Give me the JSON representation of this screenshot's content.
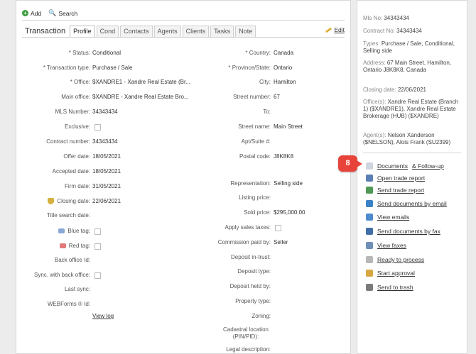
{
  "toolbar": {
    "add_label": "Add",
    "search_label": "Search"
  },
  "tabs": {
    "title": "Transaction",
    "items": [
      "Profile",
      "Cond",
      "Contacts",
      "Agents",
      "Clients",
      "Tasks",
      "Note"
    ],
    "active": "Profile",
    "edit_label": "Edit"
  },
  "left_fields": [
    {
      "label": "* Status:",
      "value": "Conditional"
    },
    {
      "label": "* Transaction type:",
      "value": "Purchase / Sale"
    },
    {
      "label": "* Office:",
      "value": "$XANDRE1 - Xandre Real Estate (Br..."
    },
    {
      "label": "Main office:",
      "value": "$XANDRE - Xandre Real Estate Bro..."
    },
    {
      "label": "MLS Number:",
      "value": "34343434"
    },
    {
      "label": "Exclusive:",
      "value": ""
    },
    {
      "label": "Contract number:",
      "value": "34343434"
    },
    {
      "label": "Offer date:",
      "value": "18/05/2021"
    },
    {
      "label": "Accepted date:",
      "value": "18/05/2021"
    },
    {
      "label": "Firm date:",
      "value": "31/05/2021"
    },
    {
      "label": "Closing date:",
      "value": "22/06/2021"
    },
    {
      "label": "Title search date:",
      "value": ""
    },
    {
      "label": "Blue tag:",
      "value": ""
    },
    {
      "label": "Red tag:",
      "value": ""
    },
    {
      "label": "Back office Id:",
      "value": ""
    },
    {
      "label": "Sync. with back office:",
      "value": ""
    },
    {
      "label": "Last sync:",
      "value": ""
    },
    {
      "label": "WEBForms ® Id:",
      "value": ""
    }
  ],
  "view_log_label": "View log",
  "right_fields": [
    {
      "label": "* Country:",
      "value": "Canada"
    },
    {
      "label": "* Province/State:",
      "value": "Ontario"
    },
    {
      "label": "City:",
      "value": "Hamilton"
    },
    {
      "label": "Street number:",
      "value": "67"
    },
    {
      "label": "To:",
      "value": ""
    },
    {
      "label": "Street name:",
      "value": "Main Street"
    },
    {
      "label": "Apt/Suite #:",
      "value": ""
    },
    {
      "label": "Postal code:",
      "value": "J8K8K8"
    },
    {
      "label": "Representation:",
      "value": "Selling side"
    },
    {
      "label": "Listing price:",
      "value": ""
    },
    {
      "label": "Sold price:",
      "value": "$295,000.00"
    },
    {
      "label": "Apply sales taxes:",
      "value": ""
    },
    {
      "label": "Commission paid by:",
      "value": "Seller"
    },
    {
      "label": "Deposit in-trust:",
      "value": ""
    },
    {
      "label": "Deposit type:",
      "value": ""
    },
    {
      "label": "Deposit held by:",
      "value": ""
    },
    {
      "label": "Property type:",
      "value": ""
    },
    {
      "label": "Zoning:",
      "value": ""
    },
    {
      "label": "Cadastral location (PIN/PID):",
      "value": ""
    },
    {
      "label": "Legal description:",
      "value": ""
    }
  ],
  "side": {
    "mls": {
      "label": "Mls No:",
      "value": "34343434"
    },
    "contract": {
      "label": "Contract No:",
      "value": "34343434"
    },
    "types": {
      "label": "Types:",
      "value": "Purchase / Sale, Conditional, Selling side"
    },
    "address": {
      "label": "Address:",
      "value": "67 Main Street, Hamilton, Ontario J8K8K8, Canada"
    },
    "closing": {
      "label": "Closing date:",
      "value": "22/06/2021"
    },
    "offices": {
      "label": "Office(s):",
      "value": "Xandre Real Estate (Branch 1) ($XANDRE1), Xandre Real Estate Brokerage (HUB) ($XANDRE)"
    },
    "agents": {
      "label": "Agent(s):",
      "value": "Nelson Xanderson ($NELSON), Alois Frank (SU2399)"
    }
  },
  "actions": [
    {
      "label": "Documents",
      "extra": "& Follow-up",
      "icon": "document-icon",
      "color": "#cfd6df"
    },
    {
      "label": "Open trade report",
      "icon": "report-icon",
      "color": "#5b7fb4"
    },
    {
      "label": "Send trade report",
      "icon": "send-report-icon",
      "color": "#4f9a55"
    },
    {
      "label": "Send documents by email",
      "icon": "email-icon",
      "color": "#3b82c4"
    },
    {
      "label": "View emails",
      "icon": "view-email-icon",
      "color": "#4d8bd0"
    },
    {
      "label": "Send documents by fax",
      "icon": "fax-icon",
      "color": "#3f6ea8"
    },
    {
      "label": "View faxes",
      "icon": "view-fax-icon",
      "color": "#6f8fb8"
    },
    {
      "label": "Ready to process",
      "icon": "process-icon",
      "color": "#b7b7b7"
    },
    {
      "label": "Start approval",
      "icon": "approval-icon",
      "color": "#d8a840"
    },
    {
      "label": "Send to trash",
      "icon": "trash-icon",
      "color": "#7a7a7a"
    }
  ],
  "badge": "8"
}
